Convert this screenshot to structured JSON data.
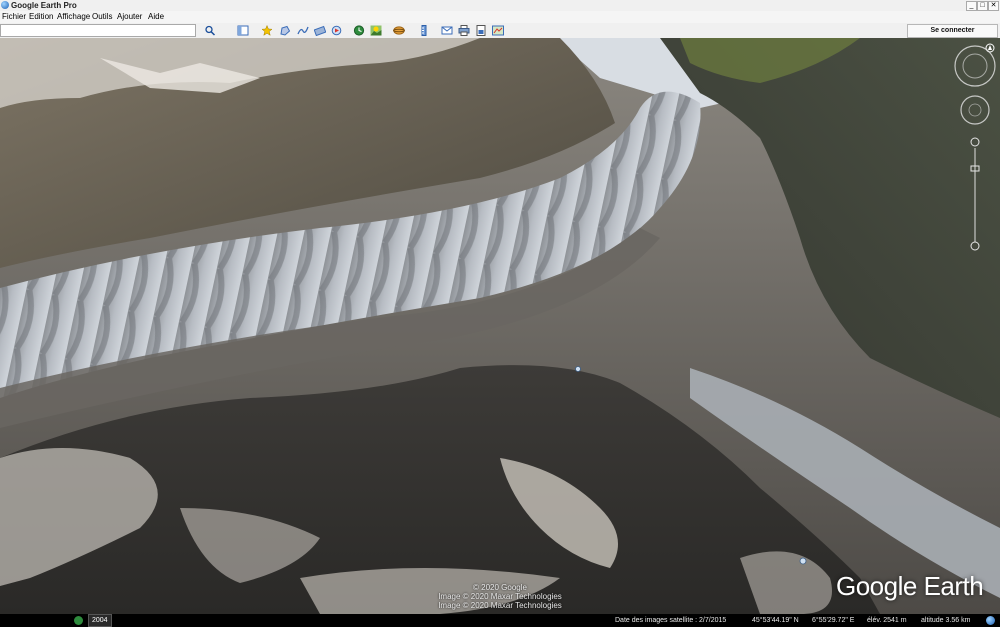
{
  "window": {
    "title": "Google Earth Pro",
    "minimize_label": "_",
    "maximize_label": "□",
    "close_label": "✕"
  },
  "menu": {
    "items": [
      "Fichier",
      "Edition",
      "Affichage",
      "Outils",
      "Ajouter",
      "Aide"
    ]
  },
  "toolbar": {
    "search_value": "",
    "search_icon": "search-icon",
    "sign_in_label": "Se connecter",
    "icons": [
      "sidebar-icon",
      "placemark-icon",
      "polygon-icon",
      "path-icon",
      "image-overlay-icon",
      "tour-icon",
      "historical-imagery-icon",
      "sun-icon",
      "planets-icon",
      "ruler-icon",
      "email-icon",
      "print-icon",
      "save-image-icon",
      "maps-icon"
    ]
  },
  "viewport": {
    "copyright_lines": [
      "© 2020 Google",
      "Image © 2020 Maxar Technologies",
      "Image © 2020 Maxar Technologies"
    ],
    "logo_text": "Google Earth"
  },
  "statusbar": {
    "historical_year": "2004",
    "imagery_date": "Date des images satellite : 2/7/2015",
    "latitude": "45°53'44.19\" N",
    "longitude": "6°55'29.72\" E",
    "elevation": "élév. 2541 m",
    "altitude": "altitude   3.56 km"
  },
  "colors": {
    "chrome": "#f0f0f0",
    "status_bg": "#000000",
    "glacier": "#c9ccd0",
    "rock": "#5a5650"
  }
}
